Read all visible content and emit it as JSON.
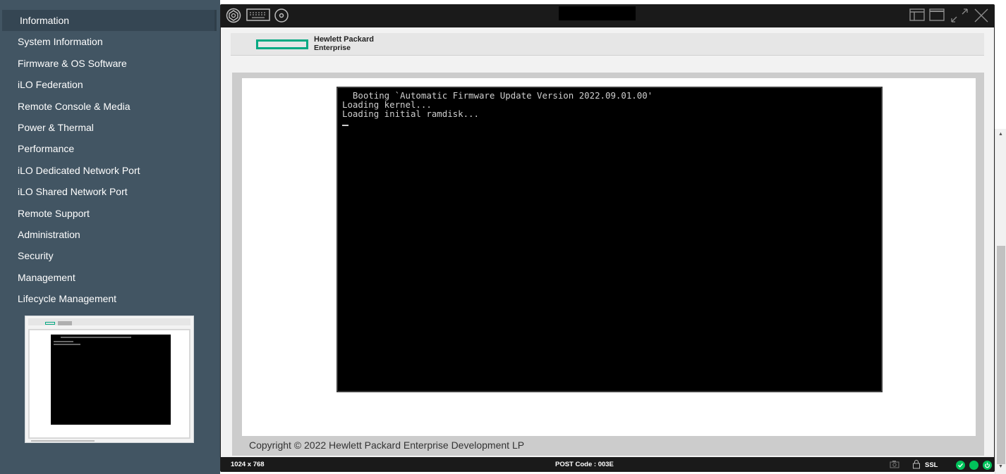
{
  "sidebar": {
    "items": [
      {
        "label": "Information"
      },
      {
        "label": "System Information"
      },
      {
        "label": "Firmware & OS Software"
      },
      {
        "label": "iLO Federation"
      },
      {
        "label": "Remote Console & Media"
      },
      {
        "label": "Power & Thermal"
      },
      {
        "label": "Performance"
      },
      {
        "label": "iLO Dedicated Network Port"
      },
      {
        "label": "iLO Shared Network Port"
      },
      {
        "label": "Remote Support"
      },
      {
        "label": "Administration"
      },
      {
        "label": "Security"
      },
      {
        "label": "Management"
      },
      {
        "label": "Lifecycle Management"
      }
    ]
  },
  "console": {
    "toolbar_icons": [
      "power-icon",
      "keyboard-icon",
      "virtual-media-icon"
    ],
    "window_icons": [
      "restore-layout-icon",
      "maximize-icon",
      "fullscreen-icon",
      "close-icon"
    ],
    "brand_line1": "Hewlett Packard",
    "brand_line2": "Enterprise",
    "screen_lines": [
      "  Booting `Automatic Firmware Update Version 2022.09.01.00'",
      "",
      "Loading kernel...",
      "Loading initial ramdisk..."
    ],
    "copyright": "Copyright © 2022 Hewlett Packard Enterprise Development LP",
    "status": {
      "resolution": "1024 x 768",
      "post_code": "POST Code : 003E",
      "ssl": "SSL"
    }
  },
  "colors": {
    "sidebar_bg": "#425563",
    "brand_green": "#01a982",
    "status_ok": "#01c35b"
  }
}
